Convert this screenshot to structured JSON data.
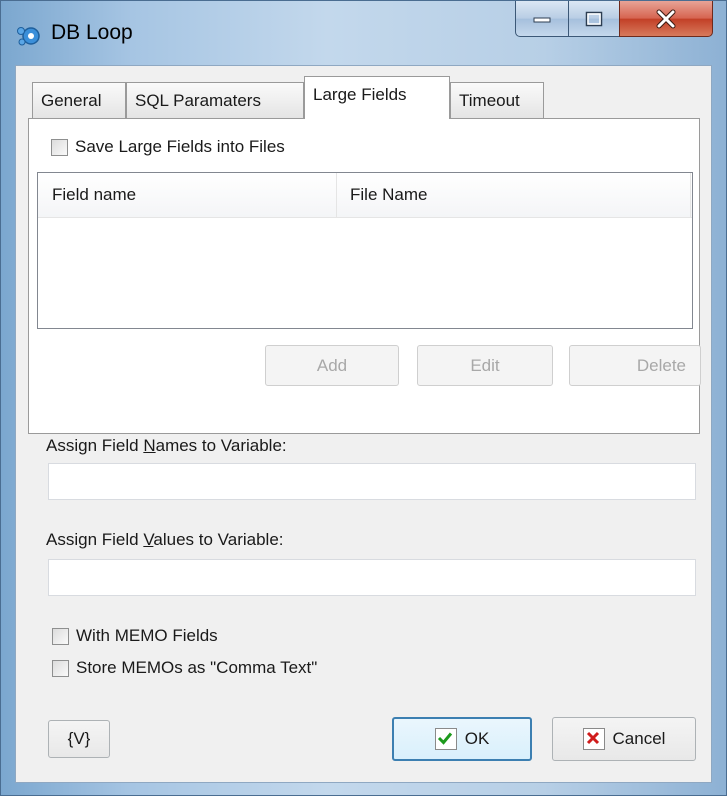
{
  "window": {
    "title": "DB Loop",
    "controls": {
      "minimize": "minimize",
      "maximize": "maximize",
      "close": "close"
    }
  },
  "tabs": [
    {
      "label": "General",
      "active": false
    },
    {
      "label": "SQL Paramaters",
      "active": false
    },
    {
      "label": "Large Fields",
      "active": true
    },
    {
      "label": "Timeout",
      "active": false
    }
  ],
  "large_fields": {
    "save_checkbox_label": "Save Large Fields into Files",
    "save_checked": false,
    "columns": [
      "Field name",
      "File Name"
    ],
    "rows": [],
    "buttons": {
      "add": "Add",
      "edit": "Edit",
      "delete": "Delete"
    }
  },
  "names_var": {
    "label_pre": "Assign Field ",
    "label_accel": "N",
    "label_post": "ames to Variable:",
    "value": ""
  },
  "values_var": {
    "label_pre": "Assign Field ",
    "label_accel": "V",
    "label_post": "alues to Variable:",
    "value": ""
  },
  "options": {
    "memo_label": "With MEMO Fields",
    "memo_checked": false,
    "comma_label": "Store MEMOs as \"Comma Text\"",
    "comma_checked": false
  },
  "footer": {
    "variables_button": "{V}",
    "ok": "OK",
    "cancel": "Cancel"
  },
  "colors": {
    "title_gradient": "#a6c5e3",
    "close_button": "#c23f26",
    "ok_check": "#1d9a1d",
    "cancel_x": "#d01c1c"
  },
  "icons": {
    "app": "db-loop-app-icon",
    "minimize": "minimize-icon",
    "maximize": "maximize-icon",
    "close": "close-icon",
    "ok": "checkmark-icon",
    "cancel": "x-mark-icon"
  }
}
